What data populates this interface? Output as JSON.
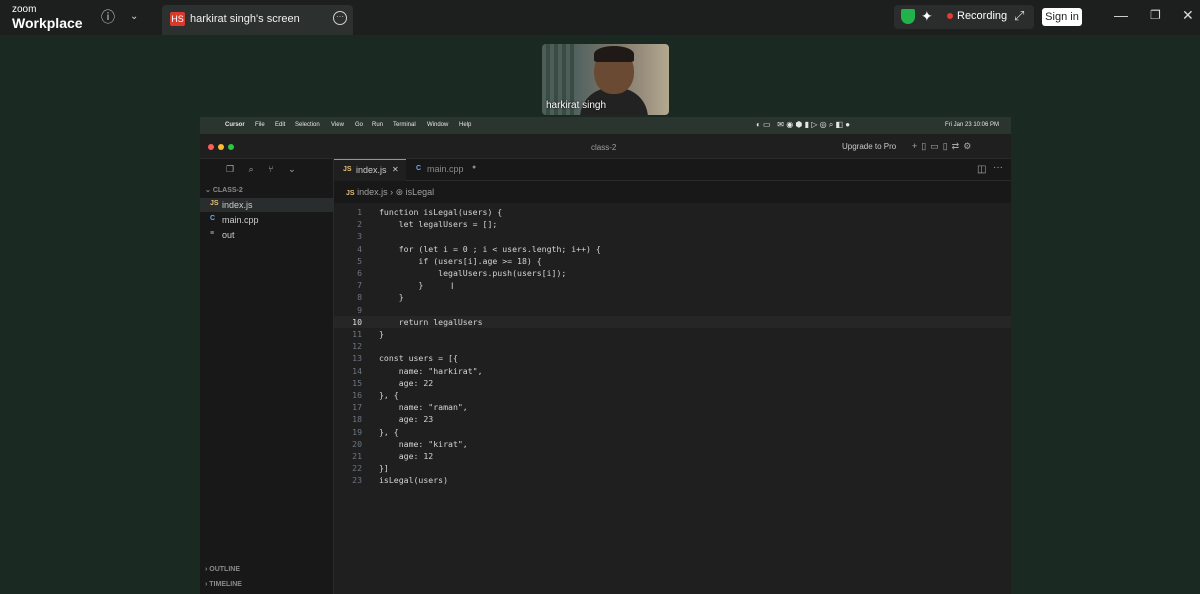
{
  "zoom": {
    "logo_line1": "zoom",
    "logo_line2": "Workplace",
    "info_icon": "info-icon",
    "share_badge": "HS",
    "share_title": "harkirat singh's screen",
    "recording_label": "Recording",
    "sign_in_label": "Sign in",
    "colors": {
      "bar": "#1c1f1e",
      "recording": "#e53935",
      "shield": "#22b24c",
      "background": "#1a2a23"
    }
  },
  "webcam": {
    "name": "harkirat singh"
  },
  "mac_menu": {
    "app": "Cursor",
    "items": [
      "File",
      "Edit",
      "Selection",
      "View",
      "Go",
      "Run",
      "Terminal",
      "Window",
      "Help"
    ],
    "clock": "Fri Jan 23  10:06 PM"
  },
  "ide": {
    "window_title": "class-2",
    "upgrade_label": "Upgrade to Pro",
    "explorer": {
      "section": "CLASS-2",
      "files": [
        {
          "icon": "JS",
          "name": "index.js",
          "active": true
        },
        {
          "icon": "C",
          "name": "main.cpp",
          "active": false
        },
        {
          "icon": "≡",
          "name": "out",
          "active": false
        }
      ],
      "outline_label": "OUTLINE",
      "timeline_label": "TIMELINE"
    },
    "tabs": [
      {
        "icon": "JS",
        "label": "index.js",
        "close": "✕"
      },
      {
        "icon": "C",
        "label": "main.cpp",
        "close": "●"
      }
    ],
    "breadcrumb": {
      "file": "index.js",
      "symbol": "isLegal"
    },
    "code_lines": [
      "function isLegal(users) {",
      "    let legalUsers = [];",
      "",
      "    for (let i = 0 ; i < users.length; i++) {",
      "        if (users[i].age >= 18) {",
      "            legalUsers.push(users[i]);",
      "        }",
      "    }",
      "",
      "    return legalUsers",
      "}",
      "",
      "const users = [{",
      "    name: \"harkirat\",",
      "    age: 22",
      "}, {",
      "    name: \"raman\",",
      "    age: 23",
      "}, {",
      "    name: \"kirat\",",
      "    age: 12",
      "}]",
      "isLegal(users)"
    ],
    "line_numbers": [
      "1",
      "2",
      "3",
      "4",
      "5",
      "6",
      "7",
      "8",
      "9",
      "10",
      "11",
      "12",
      "13",
      "14",
      "15",
      "16",
      "17",
      "18",
      "19",
      "20",
      "21",
      "22",
      "23"
    ],
    "current_line": 10
  }
}
